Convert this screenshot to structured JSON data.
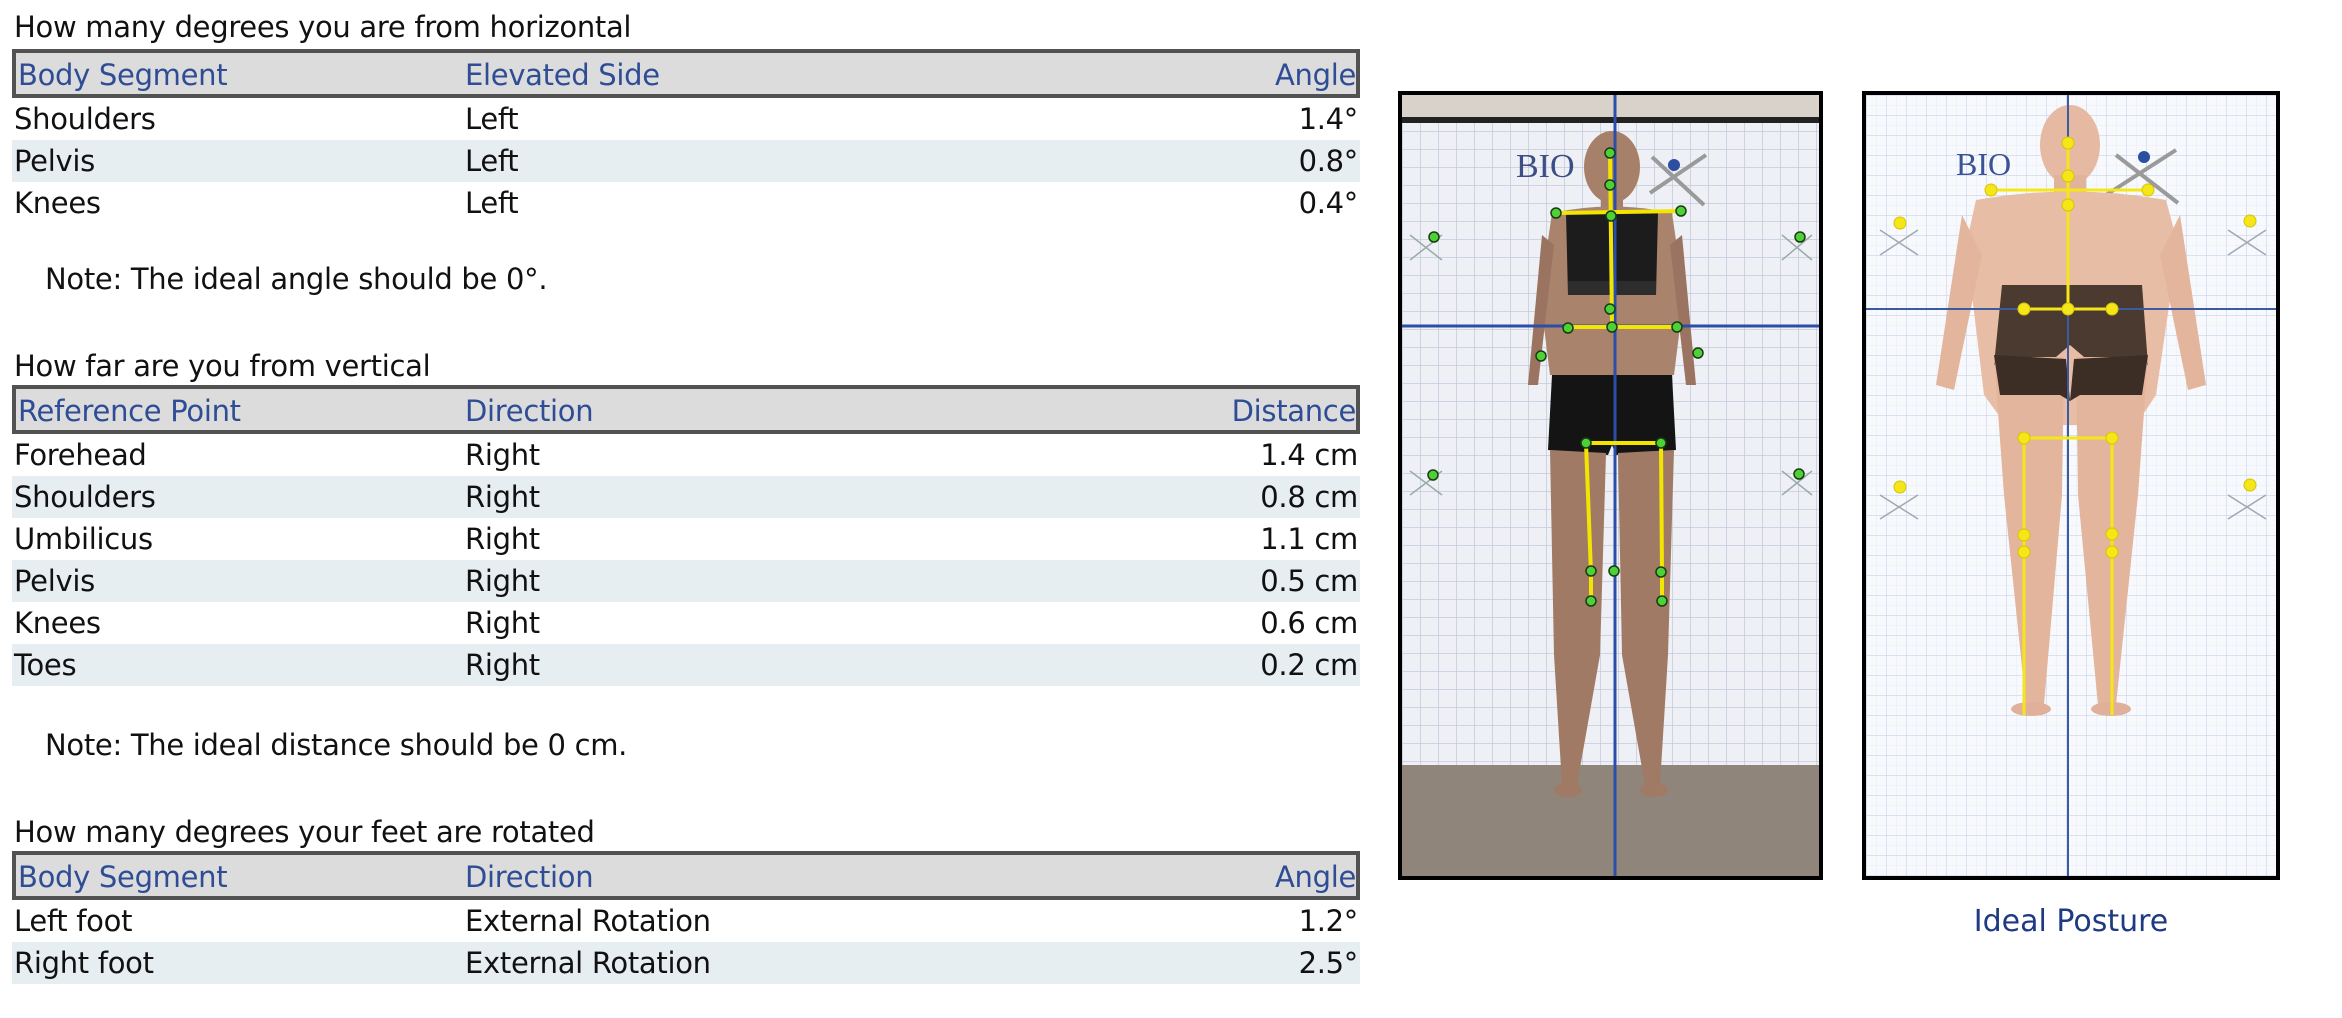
{
  "horizontal": {
    "title": "How many degrees you are from horizontal",
    "columns": [
      "Body Segment",
      "Elevated Side",
      "Angle"
    ],
    "rows": [
      [
        "Shoulders",
        "Left",
        "1.4°"
      ],
      [
        "Pelvis",
        "Left",
        "0.8°"
      ],
      [
        "Knees",
        "Left",
        "0.4°"
      ]
    ],
    "note": "Note: The ideal angle should be 0°."
  },
  "vertical": {
    "title": "How far are you from vertical",
    "columns": [
      "Reference Point",
      "Direction",
      "Distance"
    ],
    "rows": [
      [
        "Forehead",
        "Right",
        "1.4 cm"
      ],
      [
        "Shoulders",
        "Right",
        "0.8 cm"
      ],
      [
        "Umbilicus",
        "Right",
        "1.1 cm"
      ],
      [
        "Pelvis",
        "Right",
        "0.5 cm"
      ],
      [
        "Knees",
        "Right",
        "0.6 cm"
      ],
      [
        "Toes",
        "Right",
        "0.2 cm"
      ]
    ],
    "note": "Note: The ideal distance should be 0 cm."
  },
  "feet": {
    "title": "How many degrees your feet are rotated",
    "columns": [
      "Body Segment",
      "Direction",
      "Angle"
    ],
    "rows": [
      [
        "Left foot",
        "External Rotation",
        "1.2°"
      ],
      [
        "Right foot",
        "External Rotation",
        "2.5°"
      ]
    ]
  },
  "images": {
    "patient_photo": {
      "description": "Front-view posture photo with landmark markers",
      "logo_text": "BIO"
    },
    "ideal_figure": {
      "description": "Ideal posture reference figure",
      "logo_text": "BIO",
      "caption": "Ideal Posture"
    }
  },
  "colors": {
    "header_text": "#2e4d95",
    "header_bg": "#dcdcdc",
    "header_border": "#525252",
    "alt_row_bg": "#e6eef2",
    "caption": "#1e3a82",
    "plumb_line": "#2b4ea8",
    "skeleton_line": "#f2e600",
    "marker_patient": "#4cd137",
    "marker_ideal": "#f5e61a"
  }
}
